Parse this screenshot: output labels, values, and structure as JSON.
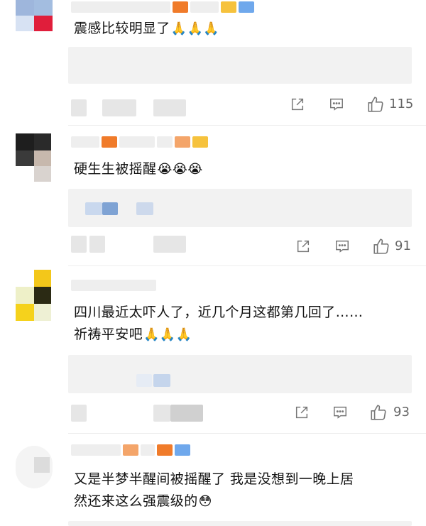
{
  "comments": [
    {
      "text_lines": [
        "震感比较明显了"
      ],
      "emoji": "🙏🙏🙏",
      "likes": "115",
      "icons": {
        "share": "share-icon",
        "comment": "comment-icon",
        "like": "thumbs-up-icon"
      }
    },
    {
      "text_lines": [
        "硬生生被摇醒"
      ],
      "emoji": "😭😭😭",
      "likes": "91",
      "icons": {
        "share": "share-icon",
        "comment": "comment-icon",
        "like": "thumbs-up-icon"
      }
    },
    {
      "text_lines": [
        "四川最近太吓人了，近几个月这都第几回了……",
        "祈祷平安吧"
      ],
      "emoji": "🙏🙏🙏",
      "likes": "93",
      "icons": {
        "share": "share-icon",
        "comment": "comment-icon",
        "like": "thumbs-up-icon"
      }
    },
    {
      "text_lines": [
        "又是半梦半醒间被摇醒了 我是没想到一晚上居",
        "然还来这么强震级的"
      ],
      "emoji": "😳"
    }
  ],
  "colors": {
    "text": "#111111",
    "meta": "#666666",
    "reply_bg": "#f2f2f2",
    "divider": "#ededed"
  }
}
